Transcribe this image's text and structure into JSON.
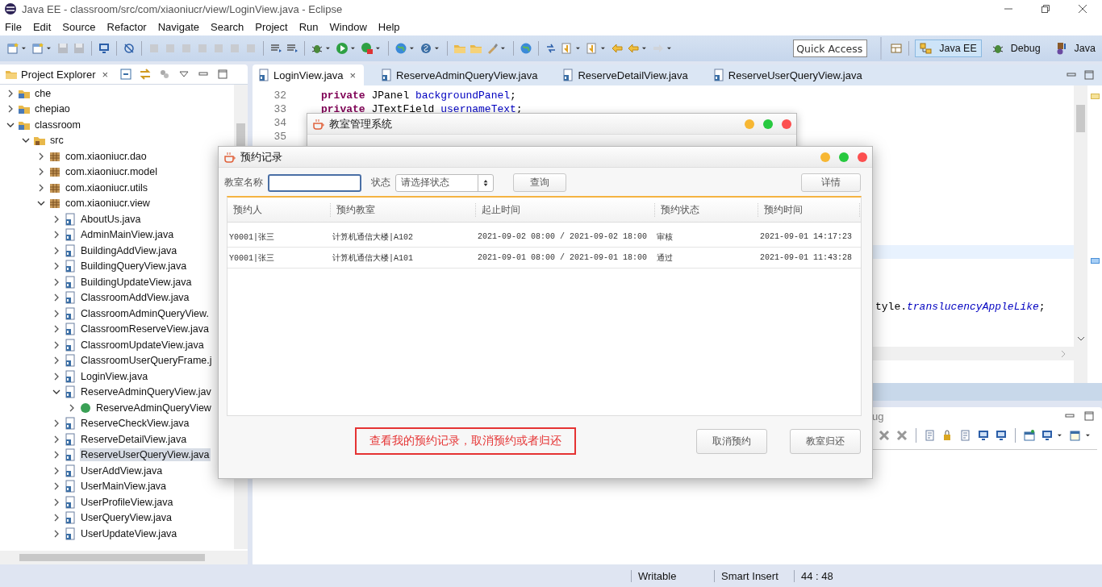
{
  "window": {
    "title": "Java EE - classroom/src/com/xiaoniucr/view/LoginView.java - Eclipse"
  },
  "menu": [
    {
      "label": "File"
    },
    {
      "label": "Edit"
    },
    {
      "label": "Source"
    },
    {
      "label": "Refactor"
    },
    {
      "label": "Navigate"
    },
    {
      "label": "Search"
    },
    {
      "label": "Project"
    },
    {
      "label": "Run"
    },
    {
      "label": "Window"
    },
    {
      "label": "Help"
    }
  ],
  "quick_access": {
    "placeholder": "Quick Access"
  },
  "perspectives": [
    {
      "label": "Java EE",
      "selected": true,
      "kind": "javaee"
    },
    {
      "label": "Debug",
      "selected": false,
      "kind": "debug"
    },
    {
      "label": "Java",
      "selected": false,
      "kind": "java"
    }
  ],
  "project_explorer": {
    "title": "Project Explorer",
    "close": "×",
    "tree": [
      {
        "label": "che",
        "kind": "project",
        "expanded": false,
        "selected": false
      },
      {
        "label": "chepiao",
        "kind": "project",
        "expanded": false,
        "selected": false
      },
      {
        "label": "classroom",
        "kind": "project",
        "expanded": true,
        "selected": false,
        "children": [
          {
            "label": "src",
            "kind": "source",
            "expanded": true,
            "selected": false,
            "children": [
              {
                "label": "com.xiaoniucr.dao",
                "kind": "package",
                "expanded": false,
                "selected": false
              },
              {
                "label": "com.xiaoniucr.model",
                "kind": "package",
                "expanded": false,
                "selected": false
              },
              {
                "label": "com.xiaoniucr.utils",
                "kind": "package",
                "expanded": false,
                "selected": false
              },
              {
                "label": "com.xiaoniucr.view",
                "kind": "package",
                "expanded": true,
                "selected": false,
                "children": [
                  {
                    "label": "AboutUs.java",
                    "kind": "file",
                    "expanded": false,
                    "selected": false
                  },
                  {
                    "label": "AdminMainView.java",
                    "kind": "file",
                    "expanded": false,
                    "selected": false
                  },
                  {
                    "label": "BuildingAddView.java",
                    "kind": "file",
                    "expanded": false,
                    "selected": false
                  },
                  {
                    "label": "BuildingQueryView.java",
                    "kind": "file",
                    "expanded": false,
                    "selected": false
                  },
                  {
                    "label": "BuildingUpdateView.java",
                    "kind": "file",
                    "expanded": false,
                    "selected": false
                  },
                  {
                    "label": "ClassroomAddView.java",
                    "kind": "file",
                    "expanded": false,
                    "selected": false
                  },
                  {
                    "label": "ClassroomAdminQueryView.",
                    "kind": "file",
                    "expanded": false,
                    "selected": false
                  },
                  {
                    "label": "ClassroomReserveView.java",
                    "kind": "file",
                    "expanded": false,
                    "selected": false
                  },
                  {
                    "label": "ClassroomUpdateView.java",
                    "kind": "file",
                    "expanded": false,
                    "selected": false
                  },
                  {
                    "label": "ClassroomUserQueryFrame.j",
                    "kind": "file",
                    "expanded": false,
                    "selected": false
                  },
                  {
                    "label": "LoginView.java",
                    "kind": "file",
                    "expanded": false,
                    "selected": false
                  },
                  {
                    "label": "ReserveAdminQueryView.jav",
                    "kind": "file",
                    "expanded": true,
                    "selected": false,
                    "children": [
                      {
                        "label": "ReserveAdminQueryView",
                        "kind": "class",
                        "expanded": false,
                        "selected": false
                      }
                    ]
                  },
                  {
                    "label": "ReserveCheckView.java",
                    "kind": "file",
                    "expanded": false,
                    "selected": false
                  },
                  {
                    "label": "ReserveDetailView.java",
                    "kind": "file",
                    "expanded": false,
                    "selected": false
                  },
                  {
                    "label": "ReserveUserQueryView.java",
                    "kind": "file",
                    "expanded": false,
                    "selected": true
                  },
                  {
                    "label": "UserAddView.java",
                    "kind": "file",
                    "expanded": false,
                    "selected": false
                  },
                  {
                    "label": "UserMainView.java",
                    "kind": "file",
                    "expanded": false,
                    "selected": false
                  },
                  {
                    "label": "UserProfileView.java",
                    "kind": "file",
                    "expanded": false,
                    "selected": false
                  },
                  {
                    "label": "UserQueryView.java",
                    "kind": "file",
                    "expanded": false,
                    "selected": false
                  },
                  {
                    "label": "UserUpdateView.java",
                    "kind": "file",
                    "expanded": false,
                    "selected": false
                  }
                ]
              }
            ]
          }
        ]
      }
    ]
  },
  "editor": {
    "tabs": [
      {
        "label": "LoginView.java",
        "selected": true,
        "close": "×"
      },
      {
        "label": "ReserveAdminQueryView.java",
        "selected": false
      },
      {
        "label": "ReserveDetailView.java",
        "selected": false
      },
      {
        "label": "ReserveUserQueryView.java",
        "selected": false
      }
    ],
    "lines": [
      {
        "number": "32",
        "segments": [
          {
            "text": "private",
            "kind": "keyword"
          },
          {
            "text": " JPanel ",
            "kind": "plain"
          },
          {
            "text": "backgroundPanel",
            "kind": "field"
          },
          {
            "text": ";",
            "kind": "plain"
          }
        ]
      },
      {
        "number": "33",
        "segments": [
          {
            "text": "private",
            "kind": "keyword"
          },
          {
            "text": " JTextField ",
            "kind": "plain"
          },
          {
            "text": "usernameText",
            "kind": "field"
          },
          {
            "text": ";",
            "kind": "plain"
          }
        ]
      },
      {
        "number": "34"
      },
      {
        "number": "35"
      }
    ],
    "fragment": [
      {
        "text": "tyle.",
        "kind": "plain"
      },
      {
        "text": "translucencyAppleLike",
        "kind": "static"
      },
      {
        "text": ";",
        "kind": "plain"
      }
    ]
  },
  "bottom_panel": {
    "tab": "ug"
  },
  "status_bar": {
    "mode": "Writable",
    "insert": "Smart Insert",
    "position": "44 : 48"
  },
  "back_dialog": {
    "title": "教室管理系统"
  },
  "dialog": {
    "title": "预约记录",
    "filters": {
      "name_label": "教室名称",
      "status_label": "状态",
      "status_placeholder": "请选择状态",
      "query_button": "查询",
      "detail_button": "详情"
    },
    "table": {
      "columns": [
        "预约人",
        "预约教室",
        "起止时间",
        "预约状态",
        "预约时间"
      ],
      "rows": [
        [
          "Y0001|张三",
          "计算机通信大楼|A102",
          "2021-09-02 08:00 / 2021-09-02 18:00",
          "审核",
          "2021-09-01 14:17:23"
        ],
        [
          "Y0001|张三",
          "计算机通信大楼|A101",
          "2021-09-01 08:00 / 2021-09-01 18:00",
          "通过",
          "2021-09-01 11:43:28"
        ]
      ]
    },
    "note": "查看我的预约记录，取消预约或者归还",
    "buttons": [
      "取消预约",
      "教室归还"
    ]
  }
}
